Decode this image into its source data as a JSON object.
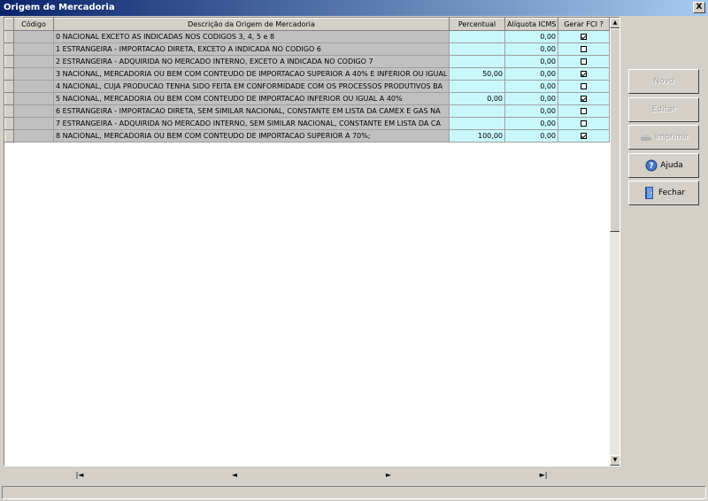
{
  "window": {
    "title": "Origem de Mercadoria",
    "close_label": "X"
  },
  "grid": {
    "headers": [
      "Código",
      "Descrição da Origem de Mercadoria",
      "Percentual",
      "Alíquota ICMS",
      "Gerar FCI ?"
    ],
    "rows": [
      {
        "desc": "0 NACIONAL EXCETO AS INDICADAS NOS CODIGOS 3, 4, 5 e 8",
        "pct": "",
        "icms": "0,00",
        "fci": true
      },
      {
        "desc": "1 ESTRANGEIRA - IMPORTACAO DIRETA, EXCETO A INDICADA NO CODIGO 6",
        "pct": "",
        "icms": "0,00",
        "fci": false
      },
      {
        "desc": "2 ESTRANGEIRA - ADQUIRIDA NO MERCADO INTERNO, EXCETO A INDICADA NO CODIGO 7",
        "pct": "",
        "icms": "0,00",
        "fci": false
      },
      {
        "desc": "3 NACIONAL, MERCADORIA OU BEM COM CONTEUDO DE IMPORTACAO SUPERIOR A 40% E INFERIOR OU IGUAL",
        "pct": "50,00",
        "icms": "0,00",
        "fci": true
      },
      {
        "desc": "4 NACIONAL, CUJA PRODUCAO TENHA SIDO FEITA EM CONFORMIDADE COM OS PROCESSOS PRODUTIVOS BA",
        "pct": "",
        "icms": "0,00",
        "fci": false
      },
      {
        "desc": "5 NACIONAL, MERCADORIA OU BEM COM CONTEUDO DE IMPORTACAO INFERIOR OU IGUAL A 40%",
        "pct": "0,00",
        "icms": "0,00",
        "fci": true
      },
      {
        "desc": "6 ESTRANGEIRA - IMPORTACAO DIRETA, SEM SIMILAR NACIONAL, CONSTANTE EM LISTA DA CAMEX E GAS NA",
        "pct": "",
        "icms": "0,00",
        "fci": false
      },
      {
        "desc": "7 ESTRANGEIRA - ADQUIRIDA NO MERCADO INTERNO, SEM SIMILAR NACIONAL, CONSTANTE EM LISTA DA CA",
        "pct": "",
        "icms": "0,00",
        "fci": false
      },
      {
        "desc": "8 NACIONAL, MERCADORIA OU BEM COM CONTEUDO DE IMPORTACAO SUPERIOR A 70%;",
        "pct": "100,00",
        "icms": "0,00",
        "fci": true
      }
    ]
  },
  "navigator": {
    "first": "|◄",
    "prev": "◄",
    "next": "►",
    "last": "►|"
  },
  "buttons": {
    "novo": "Novo",
    "editar": "Editar",
    "imprimir": "Imprimir",
    "ajuda": "Ajuda",
    "fechar": "Fechar"
  }
}
